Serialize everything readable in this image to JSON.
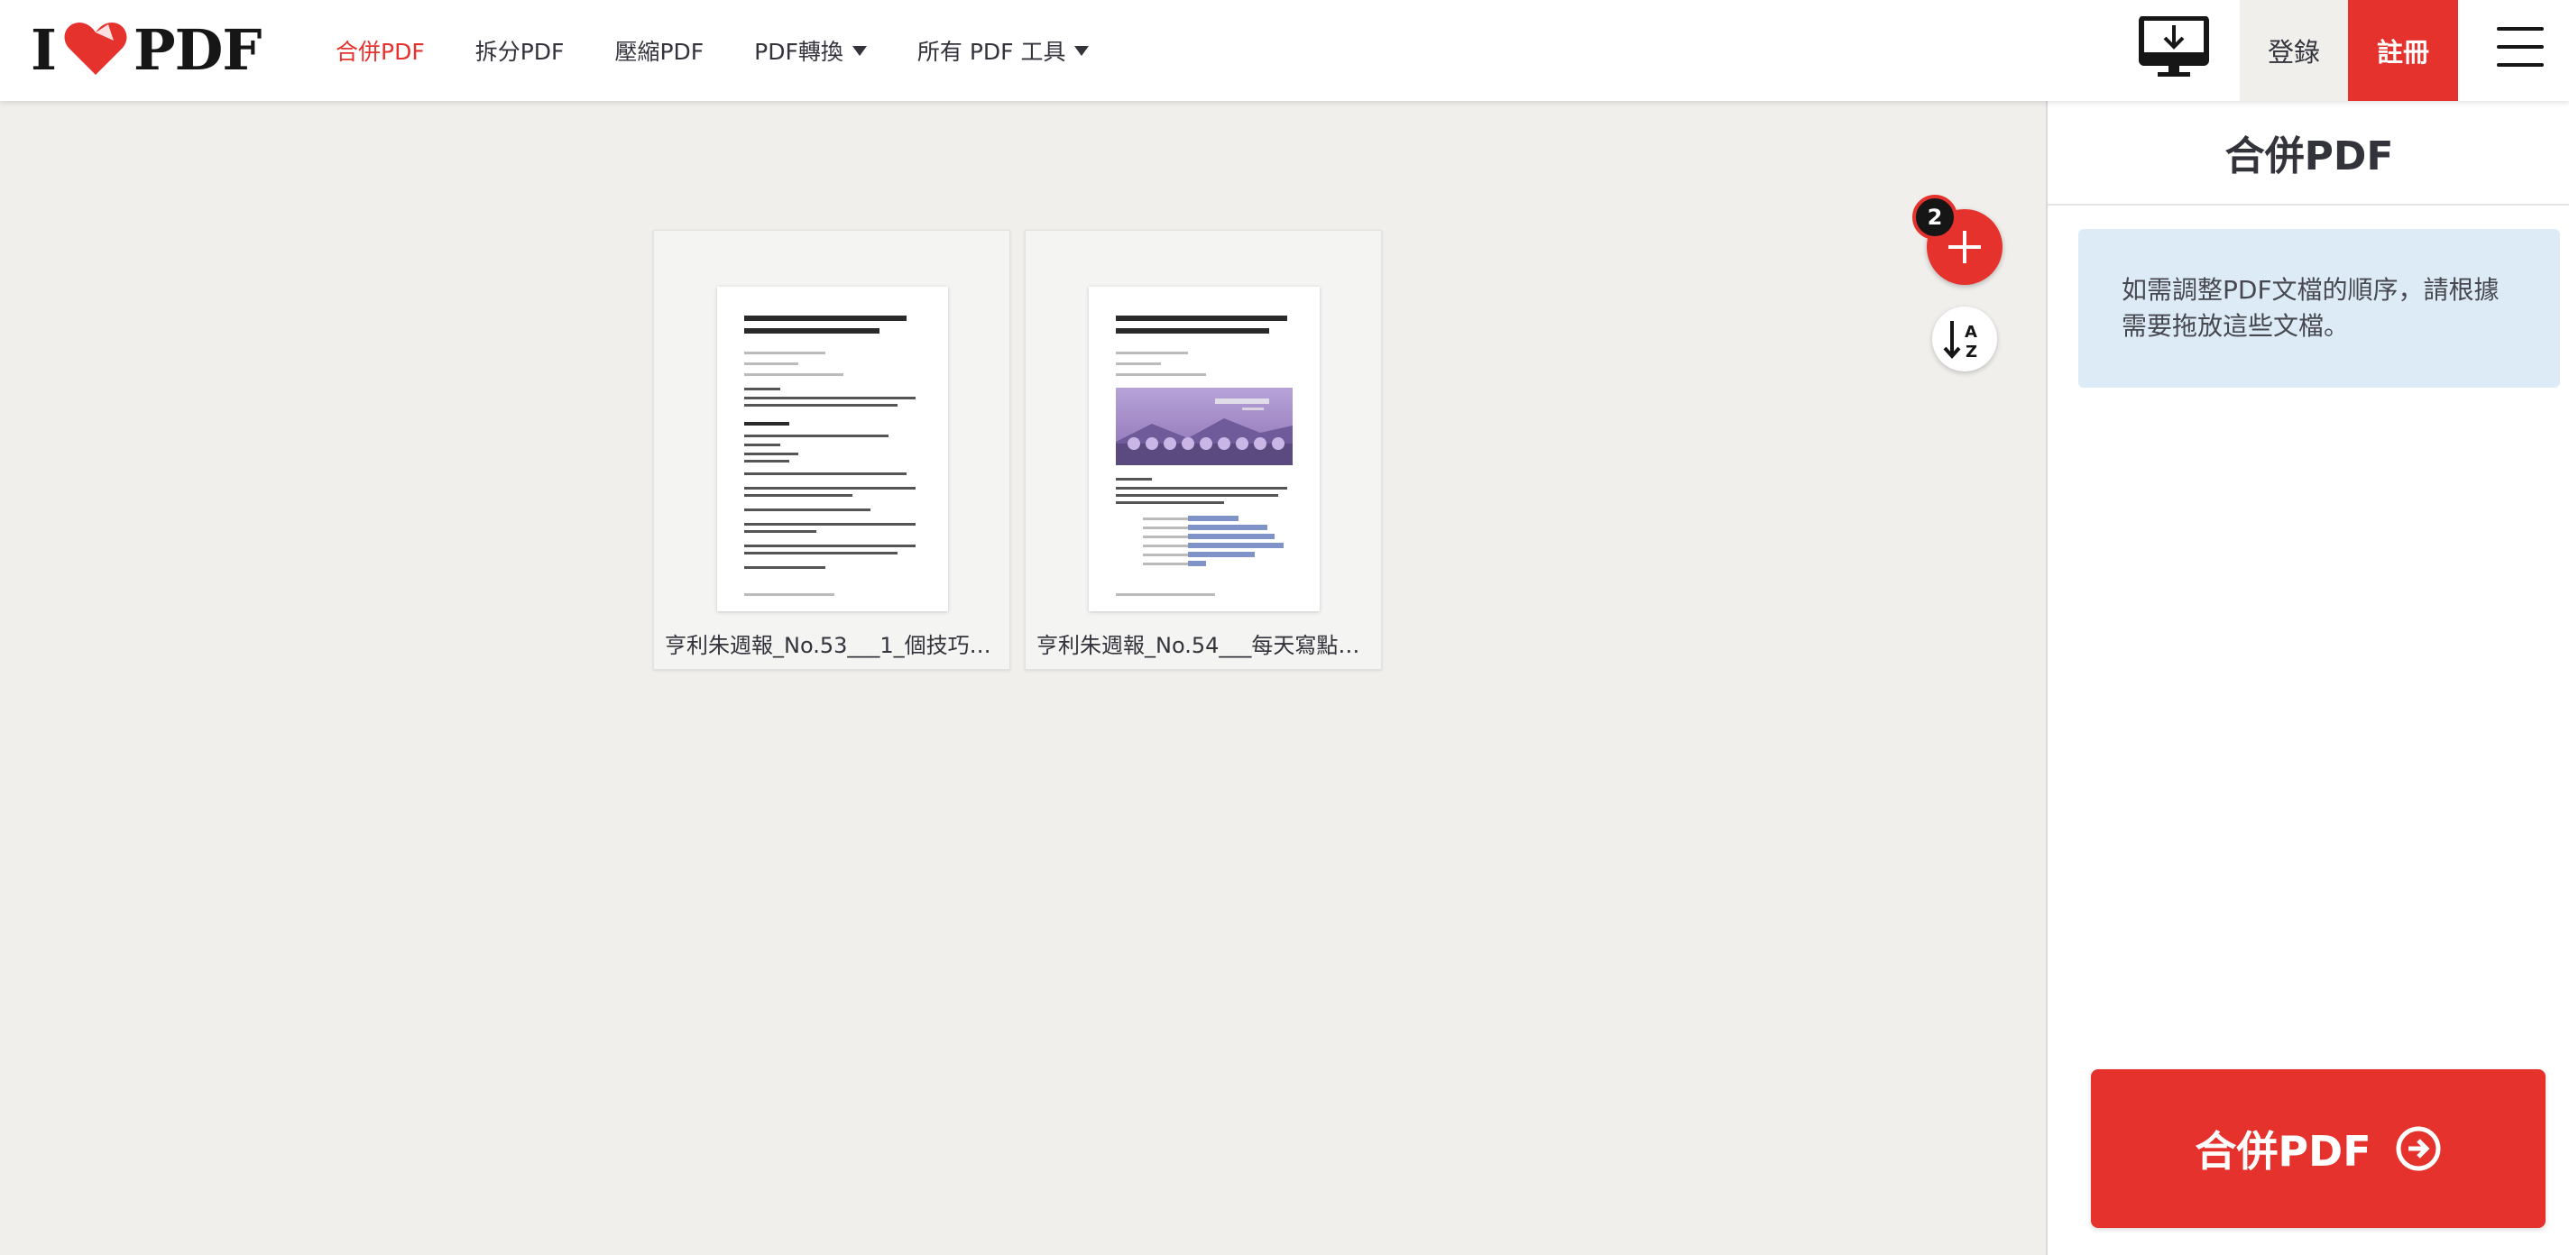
{
  "header": {
    "logo_left": "I",
    "logo_right": "PDF",
    "nav": [
      {
        "label": "合併PDF",
        "active": true
      },
      {
        "label": "拆分PDF"
      },
      {
        "label": "壓縮PDF"
      },
      {
        "label": "PDF轉換",
        "dropdown": true
      },
      {
        "label": "所有 PDF 工具",
        "dropdown": true
      }
    ],
    "login_label": "登錄",
    "signup_label": "註冊"
  },
  "workspace": {
    "file_count_badge": "2",
    "files": [
      {
        "name": "亨利朱週報_No.53___1_個技巧…"
      },
      {
        "name": "亨利朱週報_No.54___每天寫點…"
      }
    ]
  },
  "sidebar": {
    "title": "合併PDF",
    "info": "如需調整PDF文檔的順序，請根據需要拖放這些文檔。",
    "merge_label": "合併PDF"
  },
  "colors": {
    "brand_red": "#e5322d",
    "info_bg": "#ddebf7",
    "workspace_bg": "#f0efec"
  }
}
